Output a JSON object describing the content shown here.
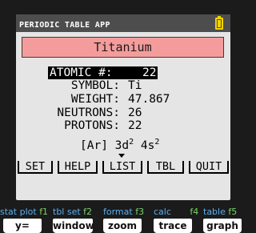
{
  "app_title": "PERIODIC TABLE APP",
  "colors": {
    "banner": "#f49c9c",
    "battery": "#f2d400",
    "key_label_blue": "#5aaef0",
    "key_label_green": "#7bd16a"
  },
  "element": {
    "name": "Titanium",
    "atomic_number_label": "ATOMIC #:",
    "atomic_number": "22",
    "symbol_label": "SYMBOL:",
    "symbol": "Ti",
    "weight_label": "WEIGHT:",
    "weight": "47.867",
    "neutrons_label": "NEUTRONS:",
    "neutrons": "26",
    "protons_label": "PROTONS:",
    "protons": "22",
    "config_core": "[Ar]",
    "config_3d": "3d",
    "config_3d_exp": "2",
    "config_4s": "4s",
    "config_4s_exp": "2"
  },
  "menu": [
    "SET",
    "HELP",
    "LIST",
    "TBL",
    "QUIT"
  ],
  "function_keys": [
    {
      "alt_label": "stat plot",
      "fn": "f1",
      "key": "y="
    },
    {
      "alt_label": "tbl set",
      "fn": "f2",
      "key": "window"
    },
    {
      "alt_label": "format",
      "fn": "f3",
      "key": "zoom"
    },
    {
      "alt_label": "calc",
      "fn": "f4",
      "key": "trace"
    },
    {
      "alt_label": "table",
      "fn": "f5",
      "key": "graph"
    }
  ]
}
